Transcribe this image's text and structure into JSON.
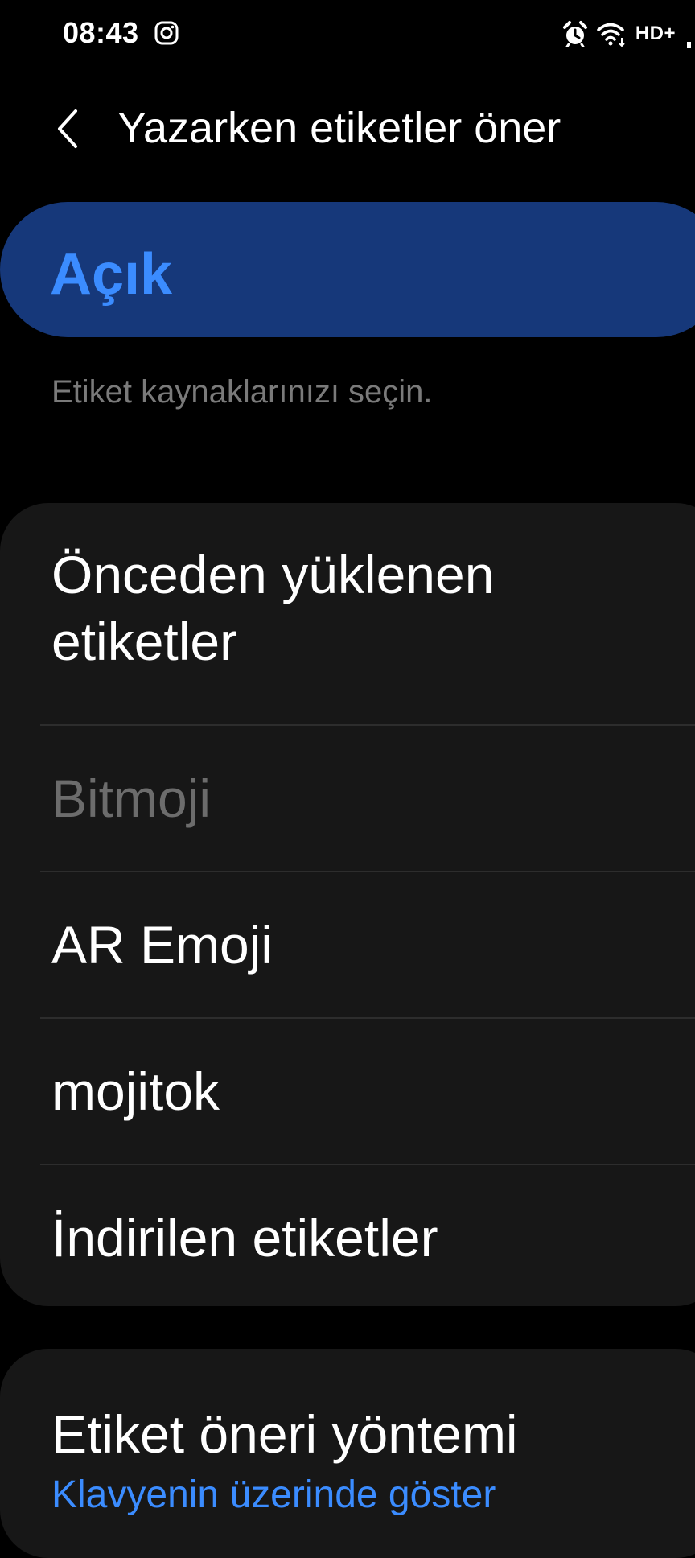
{
  "status_bar": {
    "time": "08:43",
    "network": "HD+"
  },
  "header": {
    "title": "Yazarken etiketler öner"
  },
  "master_toggle": {
    "label": "Açık"
  },
  "sources": {
    "description": "Etiket kaynaklarınızı seçin.",
    "items": [
      {
        "label_line1": "Önceden yüklenen",
        "label_line2": "etiketler"
      },
      {
        "label": "Bitmoji"
      },
      {
        "label": "AR Emoji"
      },
      {
        "label": "mojitok"
      },
      {
        "label": "İndirilen etiketler"
      }
    ]
  },
  "method": {
    "title": "Etiket öneri yöntemi",
    "value": "Klavyenin üzerinde göster"
  },
  "colors": {
    "background": "#000000",
    "card": "#171717",
    "accent": "#3b8cff",
    "toggle_bg": "#16387a",
    "muted_text": "#7a7a7a",
    "disabled_text": "#6c6c6c"
  },
  "icons": [
    "instagram-icon",
    "alarm-icon",
    "wifi-icon",
    "signal-icon",
    "back-arrow-icon"
  ]
}
